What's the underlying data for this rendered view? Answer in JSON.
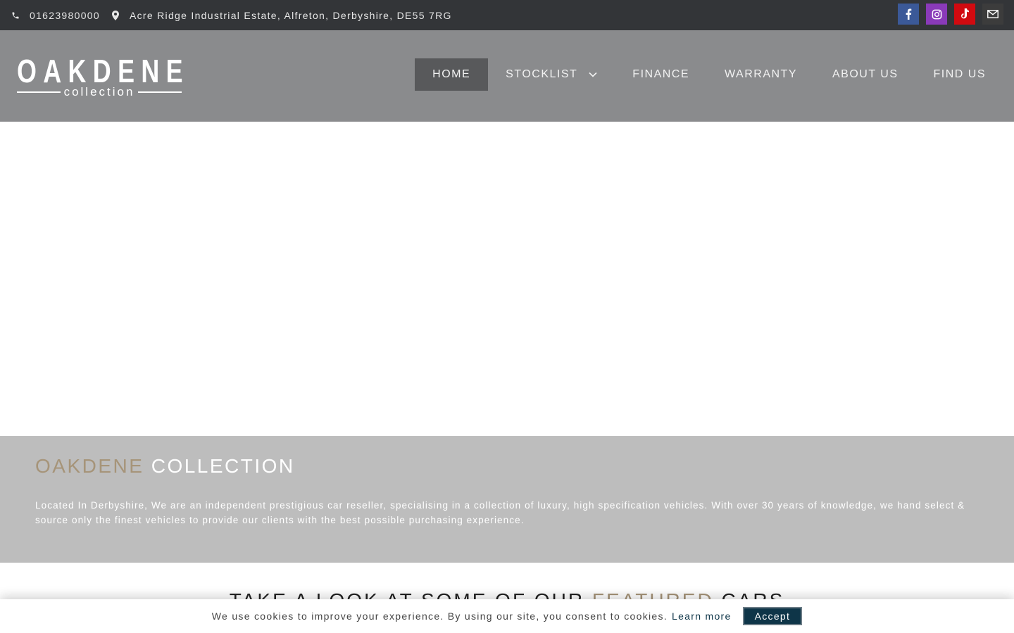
{
  "topbar": {
    "phone_icon": "phone-icon",
    "phone": "01623980000",
    "address_icon": "map-marker-icon",
    "address": "Acre Ridge Industrial Estate, Alfreton, Derbyshire, DE55 7RG",
    "social": [
      {
        "icon": "facebook-icon",
        "color": "#3b5998"
      },
      {
        "icon": "instagram-icon",
        "color": "#8a3ab9"
      },
      {
        "icon": "tiktok-icon",
        "color": "#d10a10"
      },
      {
        "icon": "email-icon",
        "color": "#3c3c3c"
      }
    ]
  },
  "logo": {
    "main": "OAKDENE",
    "sub": "collection"
  },
  "nav": {
    "items": [
      {
        "label": "HOME",
        "active": true
      },
      {
        "label": "STOCKLIST",
        "has_dropdown": true
      },
      {
        "label": "FINANCE"
      },
      {
        "label": "WARRANTY"
      },
      {
        "label": "ABOUT US"
      },
      {
        "label": "FIND US"
      }
    ]
  },
  "about": {
    "title_accent": "OAKDENE",
    "title_rest": "COLLECTION",
    "description": "Located In Derbyshire, We are an independent prestigious car reseller, specialising in a collection of luxury, high specification vehicles. With over 30 years of knowledge, we hand select & source only the finest vehicles to provide our clients with the best possible purchasing experience."
  },
  "featured": {
    "prefix": "TAKE A LOOK AT SOME OF OUR",
    "accent": "FEATURED",
    "suffix": "CARS"
  },
  "cookie": {
    "message": "We use cookies to improve your experience. By using our site, you consent to cookies.",
    "learn_more": "Learn more",
    "accept": "Accept"
  },
  "colors": {
    "accent": "#a69479",
    "topbar_bg": "#333538",
    "header_bg": "#8a8b8d",
    "nav_active_bg": "#58595b",
    "about_bg": "#bdbdbd",
    "accept_bg": "#0e3548"
  }
}
